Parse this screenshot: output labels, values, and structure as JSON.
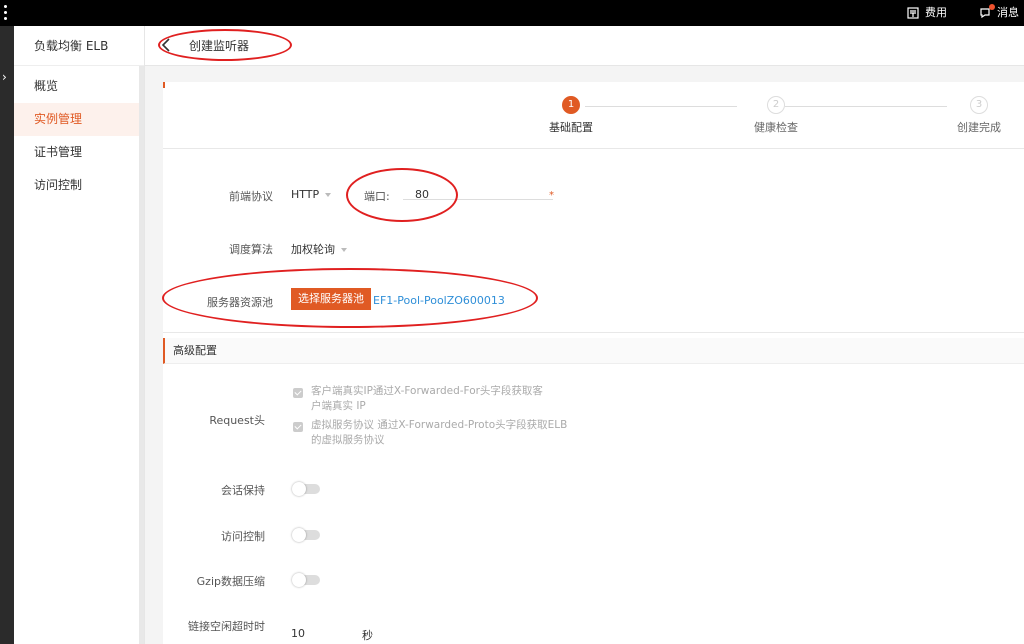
{
  "topbar": {
    "billing_label": "费用",
    "messages_label": "消息"
  },
  "sidebar": {
    "title": "负载均衡 ELB",
    "items": [
      {
        "label": "概览"
      },
      {
        "label": "实例管理"
      },
      {
        "label": "证书管理"
      },
      {
        "label": "访问控制"
      }
    ],
    "active_index": 1
  },
  "header": {
    "title": "创建监听器"
  },
  "steps": [
    {
      "num": "1",
      "label": "基础配置",
      "state": "active"
    },
    {
      "num": "2",
      "label": "健康检查",
      "state": "todo"
    },
    {
      "num": "3",
      "label": "创建完成",
      "state": "todo"
    }
  ],
  "basic": {
    "protocol_label": "前端协议",
    "protocol_value": "HTTP",
    "port_label": "端口:",
    "port_value": "80",
    "algo_label": "调度算法",
    "algo_value": "加权轮询",
    "pool_label": "服务器资源池",
    "pool_button": "选择服务器池",
    "pool_selected": "EF1-Pool-PoolZO600013"
  },
  "advanced": {
    "section_title": "高级配置",
    "request_label": "Request头",
    "check1_line1": "客户端真实IP通过X-Forwarded-For头字段获取客",
    "check1_line2": "户端真实 IP",
    "check2_line1": "虚拟服务协议 通过X-Forwarded-Proto头字段获取ELB",
    "check2_line2": "的虚拟服务协议",
    "session_label": "会话保持",
    "acl_label": "访问控制",
    "gzip_label": "Gzip数据压缩",
    "idle_label": "链接空闲超时时",
    "idle_value": "10",
    "idle_unit": "秒"
  },
  "colors": {
    "accent": "#e05a24",
    "link": "#2f8fd8",
    "annotation": "#e02020"
  }
}
